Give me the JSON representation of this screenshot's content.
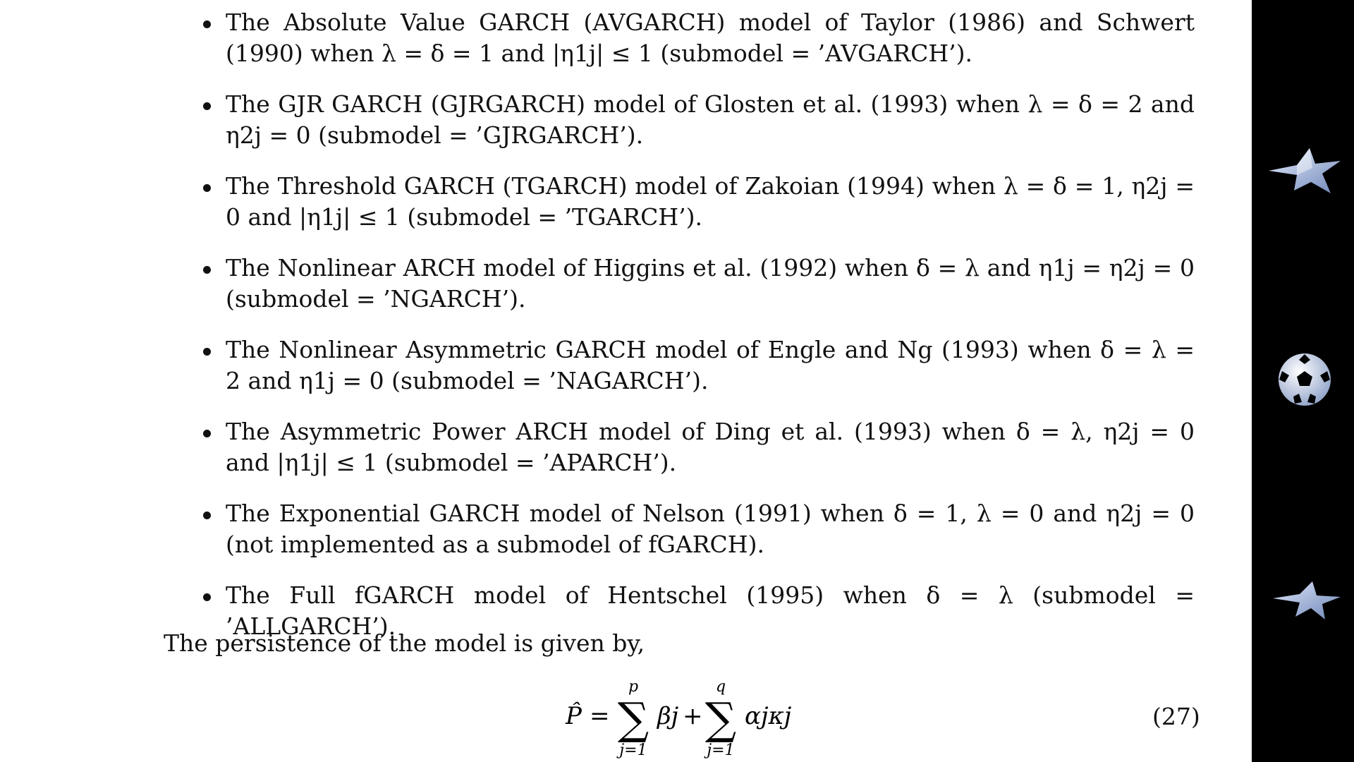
{
  "document": {
    "bullets": [
      "The Absolute Value GARCH (AVGARCH) model of Taylor (1986) and Schwert (1990) when λ = δ = 1 and |η1j| ≤ 1 (submodel = ’AVGARCH’).",
      "The GJR GARCH (GJRGARCH) model of Glosten et al. (1993) when λ = δ = 2 and η2j = 0 (submodel = ’GJRGARCH’).",
      "The Threshold GARCH (TGARCH) model of Zakoian (1994) when λ = δ = 1, η2j = 0 and |η1j| ≤ 1 (submodel = ’TGARCH’).",
      "The Nonlinear ARCH model of Higgins et al. (1992) when δ = λ and η1j = η2j = 0 (submodel = ’NGARCH’).",
      "The Nonlinear Asymmetric GARCH model of Engle and Ng (1993) when δ = λ = 2 and η1j = 0 (submodel = ’NAGARCH’).",
      "The Asymmetric Power ARCH model of Ding et al. (1993) when δ = λ, η2j = 0 and |η1j| ≤ 1 (submodel = ’APARCH’).",
      "The Exponential GARCH model of Nelson (1991) when δ = 1, λ = 0 and η2j = 0 (not implemented as a submodel of fGARCH).",
      "The Full fGARCH model of Hentschel (1995) when δ = λ (submodel = ’ALLGARCH’)."
    ],
    "paragraph": "The persistence of the model is given by,",
    "equation": {
      "lhs": "P̂",
      "equals": "=",
      "sum1_upper": "p",
      "sum1_lower": "j=1",
      "term1": "βj",
      "plus": "+",
      "sum2_upper": "q",
      "sum2_lower": "j=1",
      "term2": "αjκj",
      "number": "(27)"
    }
  },
  "sidebar": {
    "icons": [
      "star-icon",
      "football-icon",
      "star-icon"
    ],
    "background": "#000000",
    "icon_color": "#b8c8e8"
  }
}
